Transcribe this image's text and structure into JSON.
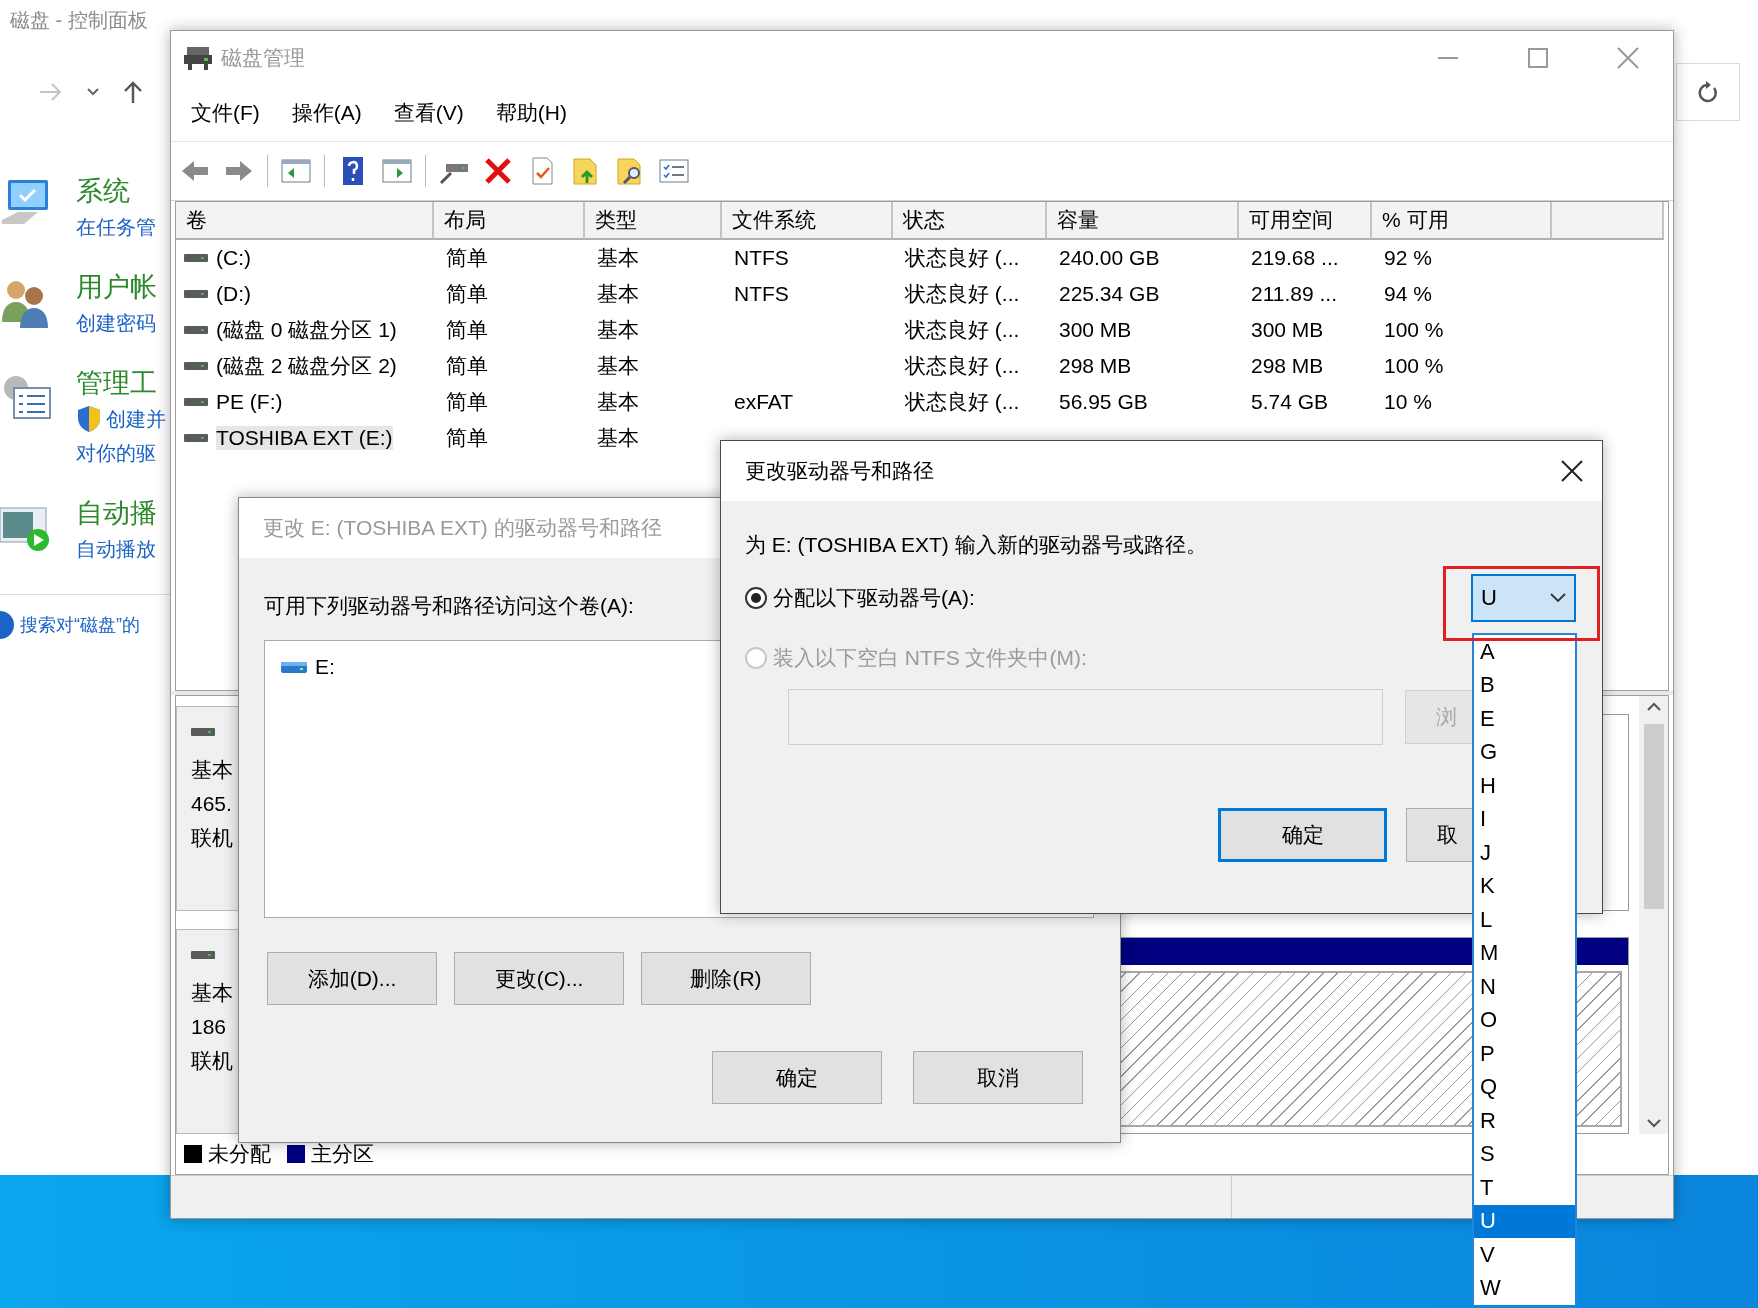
{
  "control_panel": {
    "title": "磁盘 - 控制面板",
    "categories": [
      {
        "title": "系统",
        "links": [
          {
            "text": "在任务管",
            "kind": "plain"
          }
        ]
      },
      {
        "title": "用户帐",
        "links": [
          {
            "text": "创建密码",
            "kind": "plain"
          }
        ]
      },
      {
        "title": "管理工",
        "links": [
          {
            "text": "创建并",
            "kind": "shield"
          },
          {
            "text": "对你的驱",
            "kind": "plain"
          }
        ]
      },
      {
        "title": "自动播",
        "links": [
          {
            "text": "自动播放",
            "kind": "plain"
          }
        ]
      }
    ],
    "help_link": "搜索对“磁盘”的"
  },
  "disk_management": {
    "title": "磁盘管理",
    "menu": [
      "文件(F)",
      "操作(A)",
      "查看(V)",
      "帮助(H)"
    ],
    "columns": [
      "卷",
      "布局",
      "类型",
      "文件系统",
      "状态",
      "容量",
      "可用空间",
      "% 可用"
    ],
    "rows": [
      {
        "cells": [
          "(C:)",
          "简单",
          "基本",
          "NTFS",
          "状态良好 (...",
          "240.00 GB",
          "219.68 ...",
          "92 %"
        ],
        "selected": false
      },
      {
        "cells": [
          "(D:)",
          "简单",
          "基本",
          "NTFS",
          "状态良好 (...",
          "225.34 GB",
          "211.89 ...",
          "94 %"
        ],
        "selected": false
      },
      {
        "cells": [
          "(磁盘 0 磁盘分区 1)",
          "简单",
          "基本",
          null,
          "状态良好 (...",
          "300 MB",
          "300 MB",
          "100 %"
        ],
        "selected": false
      },
      {
        "cells": [
          "(磁盘 2 磁盘分区 2)",
          "简单",
          "基本",
          null,
          "状态良好 (...",
          "298 MB",
          "298 MB",
          "100 %"
        ],
        "selected": false
      },
      {
        "cells": [
          "PE (F:)",
          "简单",
          "基本",
          "exFAT",
          "状态良好 (...",
          "56.95 GB",
          "5.74 GB",
          "10 %"
        ],
        "selected": false
      },
      {
        "cells": [
          "TOSHIBA EXT (E:)",
          "简单",
          "基本"
        ],
        "selected": true
      }
    ],
    "disks": [
      {
        "lines": [
          "基本",
          "465.",
          "联机"
        ]
      },
      {
        "lines": [
          "基本",
          "186",
          "联机"
        ]
      }
    ],
    "legend": [
      {
        "label": "未分配",
        "color": "#000000"
      },
      {
        "label": "主分区",
        "color": "#000080"
      }
    ]
  },
  "paths_dialog": {
    "title": "更改 E: (TOSHIBA EXT) 的驱动器号和路径",
    "label": "可用下列驱动器号和路径访问这个卷(A):",
    "paths": [
      "E:"
    ],
    "buttons": [
      "添加(D)...",
      "更改(C)...",
      "删除(R)"
    ],
    "footer_buttons": [
      "确定",
      "取消"
    ]
  },
  "letter_dialog": {
    "title": "更改驱动器号和路径",
    "description": "为 E: (TOSHIBA EXT) 输入新的驱动器号或路径。",
    "options": [
      {
        "label": "分配以下驱动器号(A):",
        "selected": true,
        "disabled": false
      },
      {
        "label": "装入以下空白 NTFS 文件夹中(M):",
        "selected": false,
        "disabled": true
      }
    ],
    "browse_button": {
      "label": "浏",
      "disabled": true
    },
    "buttons": [
      {
        "label": "确定",
        "default": true
      },
      {
        "label": "取",
        "default": false
      }
    ],
    "drive_letter": {
      "value": "U",
      "options": [
        {
          "label": "A",
          "selected": false
        },
        {
          "label": "B",
          "selected": false
        },
        {
          "label": "E",
          "selected": false
        },
        {
          "label": "G",
          "selected": false
        },
        {
          "label": "H",
          "selected": false
        },
        {
          "label": "I",
          "selected": false
        },
        {
          "label": "J",
          "selected": false
        },
        {
          "label": "K",
          "selected": false
        },
        {
          "label": "L",
          "selected": false
        },
        {
          "label": "M",
          "selected": false
        },
        {
          "label": "N",
          "selected": false
        },
        {
          "label": "O",
          "selected": false
        },
        {
          "label": "P",
          "selected": false
        },
        {
          "label": "Q",
          "selected": false
        },
        {
          "label": "R",
          "selected": false
        },
        {
          "label": "S",
          "selected": false
        },
        {
          "label": "T",
          "selected": false
        },
        {
          "label": "U",
          "selected": true
        },
        {
          "label": "V",
          "selected": false
        },
        {
          "label": "W",
          "selected": false
        }
      ]
    }
  }
}
